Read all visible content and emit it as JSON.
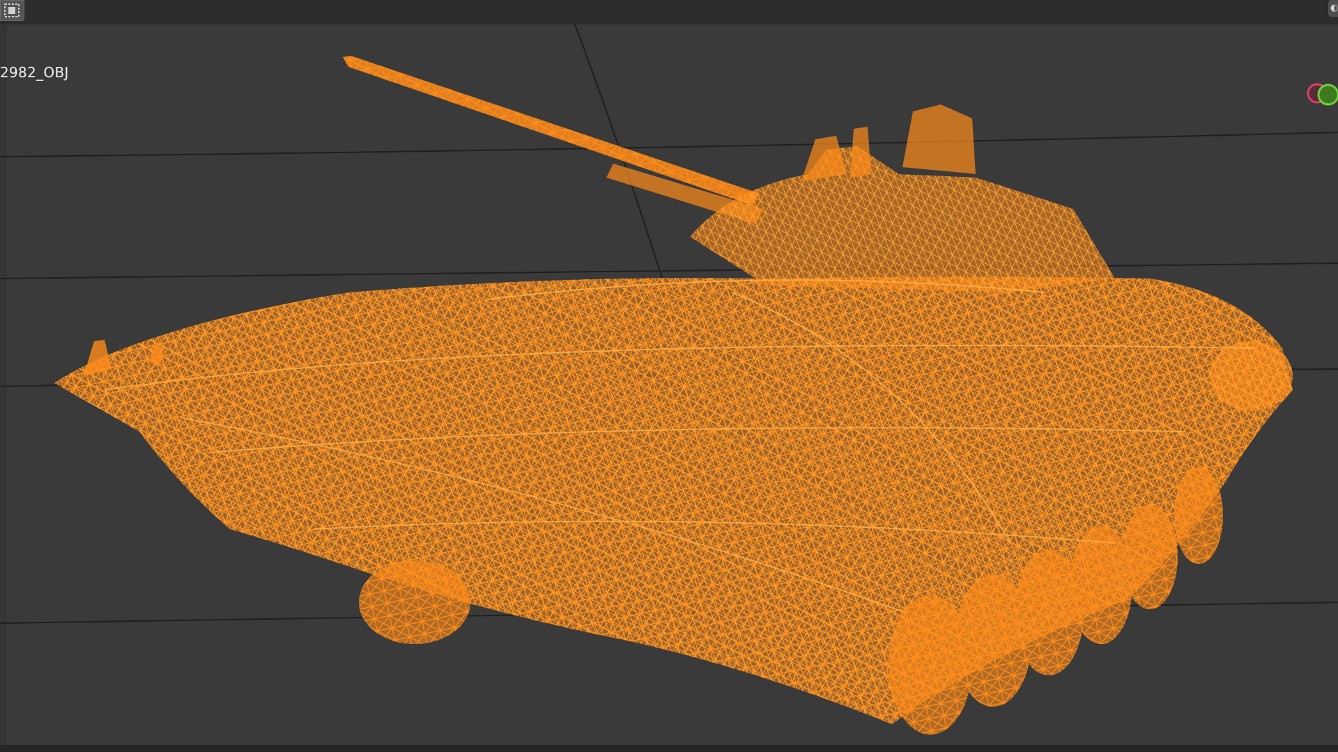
{
  "viewport": {
    "object_label": "2982_OBJ",
    "background_color": "#3a3a3a",
    "wire_color": "#ff8c1a"
  },
  "toolbar": {
    "select_tool_icon": "box-select-icon",
    "corner_button_icon": "corner-toggle-icon"
  },
  "gizmo": {
    "x_axis_color": "#d9406a",
    "y_axis_color": "#6fd13a"
  }
}
